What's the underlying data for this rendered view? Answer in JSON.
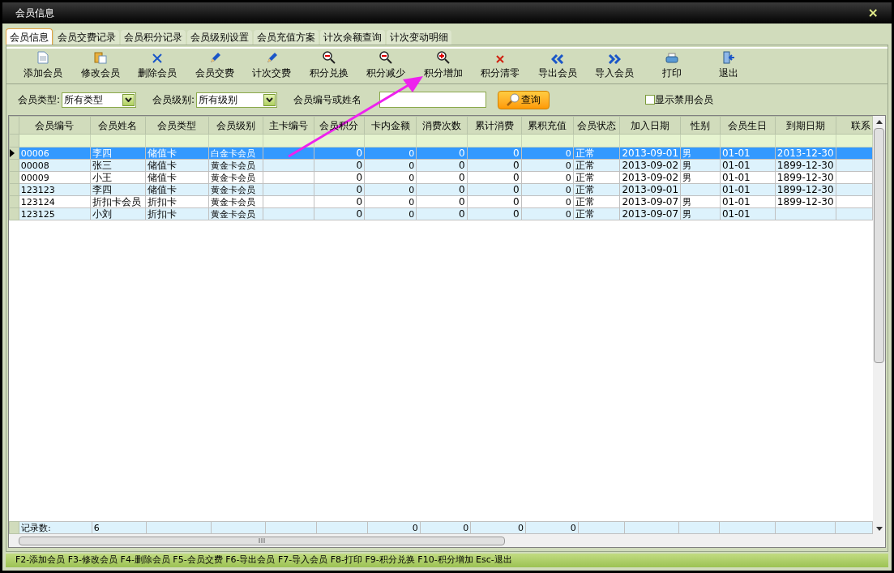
{
  "window": {
    "title": "会员信息",
    "close": "×"
  },
  "tabs": [
    {
      "label": "会员信息",
      "selected": true
    },
    {
      "label": "会员交费记录",
      "selected": false
    },
    {
      "label": "会员积分记录",
      "selected": false
    },
    {
      "label": "会员级别设置",
      "selected": false
    },
    {
      "label": "会员充值方案",
      "selected": false
    },
    {
      "label": "计次余额查询",
      "selected": false
    },
    {
      "label": "计次变动明细",
      "selected": false
    }
  ],
  "toolbar": [
    "添加会员",
    "修改会员",
    "删除会员",
    "会员交费",
    "计次交费",
    "积分兑换",
    "积分减少",
    "积分增加",
    "积分清零",
    "导出会员",
    "导入会员",
    "打印",
    "退出"
  ],
  "filters": {
    "type_label": "会员类型:",
    "type_value": "所有类型",
    "level_label": "会员级别:",
    "level_value": "所有级别",
    "search_label": "会员编号或姓名",
    "search_button": "查询",
    "show_disabled": {
      "label": "显示禁用会员",
      "checked": false
    }
  },
  "table": {
    "columns": [
      {
        "label": "会员编号",
        "kind": "text"
      },
      {
        "label": "会员姓名",
        "kind": "text"
      },
      {
        "label": "会员类型",
        "kind": "text"
      },
      {
        "label": "会员级别",
        "kind": "text"
      },
      {
        "label": "主卡编号",
        "kind": "text"
      },
      {
        "label": "会员积分",
        "kind": "number"
      },
      {
        "label": "卡内金额",
        "kind": "number"
      },
      {
        "label": "消费次数",
        "kind": "number"
      },
      {
        "label": "累计消费",
        "kind": "number"
      },
      {
        "label": "累积充值",
        "kind": "number"
      },
      {
        "label": "会员状态",
        "kind": "text"
      },
      {
        "label": "加入日期",
        "kind": "text"
      },
      {
        "label": "性别",
        "kind": "text"
      },
      {
        "label": "会员生日",
        "kind": "text"
      },
      {
        "label": "到期日期",
        "kind": "text"
      },
      {
        "label": "联系",
        "kind": "cut"
      }
    ],
    "rows": [
      {
        "selected": true,
        "cells": [
          "00006",
          "李四",
          "储值卡",
          "白金卡会员",
          "",
          "0",
          "0",
          "0",
          "0",
          "0",
          "正常",
          "2013-09-01",
          "男",
          "01-01",
          "2013-12-30",
          ""
        ]
      },
      {
        "selected": false,
        "cells": [
          "00008",
          "张三",
          "储值卡",
          "黄金卡会员",
          "",
          "0",
          "0",
          "0",
          "0",
          "0",
          "正常",
          "2013-09-02",
          "男",
          "01-01",
          "1899-12-30",
          ""
        ]
      },
      {
        "selected": false,
        "cells": [
          "00009",
          "小王",
          "储值卡",
          "黄金卡会员",
          "",
          "0",
          "0",
          "0",
          "0",
          "0",
          "正常",
          "2013-09-02",
          "男",
          "01-01",
          "1899-12-30",
          ""
        ]
      },
      {
        "selected": false,
        "cells": [
          "123123",
          "李四",
          "储值卡",
          "黄金卡会员",
          "",
          "0",
          "0",
          "0",
          "0",
          "0",
          "正常",
          "2013-09-01",
          "",
          "01-01",
          "1899-12-30",
          ""
        ]
      },
      {
        "selected": false,
        "cells": [
          "123124",
          "折扣卡会员",
          "折扣卡",
          "黄金卡会员",
          "",
          "0",
          "0",
          "0",
          "0",
          "0",
          "正常",
          "2013-09-07",
          "男",
          "01-01",
          "1899-12-30",
          ""
        ]
      },
      {
        "selected": false,
        "cells": [
          "123125",
          "小刘",
          "折扣卡",
          "黄金卡会员",
          "",
          "0",
          "0",
          "0",
          "0",
          "0",
          "正常",
          "2013-09-07",
          "男",
          "01-01",
          "",
          ""
        ]
      }
    ],
    "footer": {
      "label": "记录数:",
      "count": "6",
      "totals": [
        "0",
        "0",
        "0",
        "0"
      ]
    }
  },
  "status_bar": "F2-添加会员 F3-修改会员 F4-删除会员 F5-会员交费 F6-导出会员 F7-导入会员 F8-打印 F9-积分兑换 F10-积分增加 Esc-退出"
}
